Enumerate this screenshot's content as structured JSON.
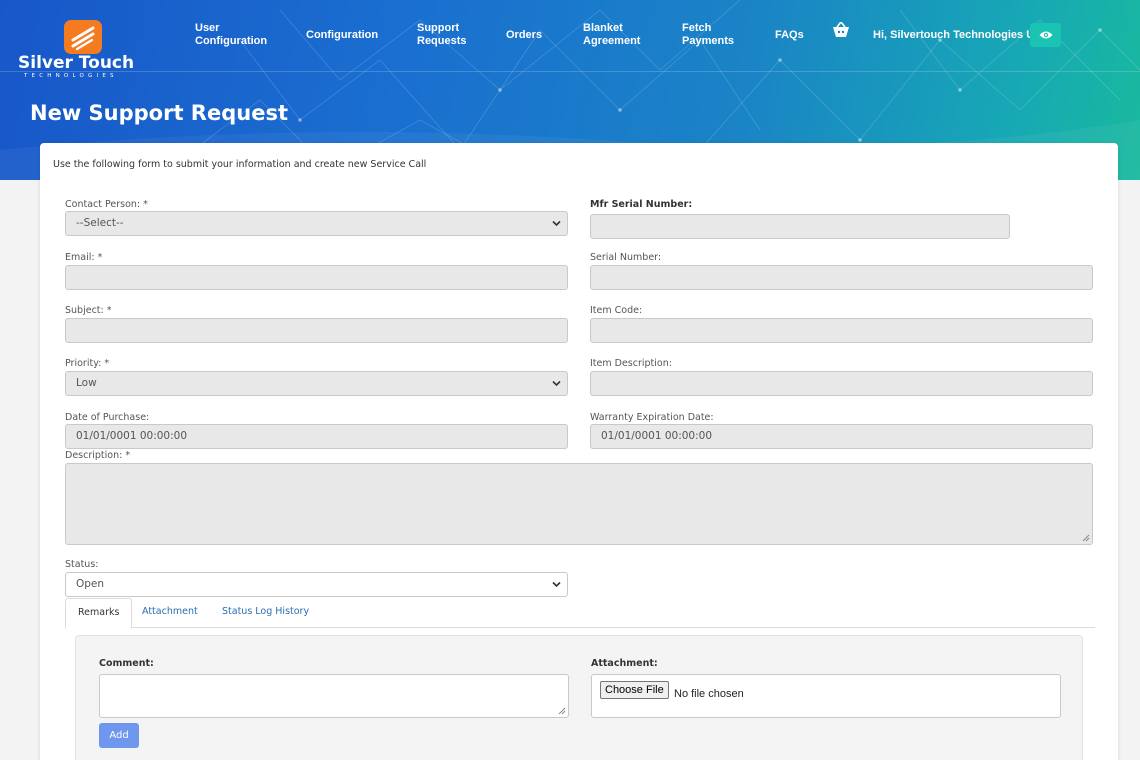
{
  "brand": {
    "name": "Silver Touch",
    "tagline": "TECHNOLOGIES"
  },
  "nav": {
    "items": [
      {
        "line1": "User",
        "line2": "Configuration"
      },
      {
        "line1": "Configuration",
        "line2": ""
      },
      {
        "line1": "Support",
        "line2": "Requests"
      },
      {
        "line1": "Orders",
        "line2": ""
      },
      {
        "line1": "Blanket",
        "line2": "Agreement"
      },
      {
        "line1": "Fetch",
        "line2": "Payments"
      },
      {
        "line1": "FAQs",
        "line2": ""
      }
    ],
    "greeting": "Hi, Silvertouch Technologies UK",
    "cart_icon": "cart-icon",
    "eye_icon": "eye-icon"
  },
  "page": {
    "title": "New Support Request",
    "intro": "Use the following form to submit your information and create new Service Call"
  },
  "form": {
    "contact_person": {
      "label": "Contact Person: *",
      "value": "--Select--"
    },
    "mfr_serial": {
      "label": "Mfr Serial Number:",
      "value": ""
    },
    "email": {
      "label": "Email: *",
      "value": ""
    },
    "serial_number": {
      "label": "Serial Number:",
      "value": ""
    },
    "subject": {
      "label": "Subject: *",
      "value": ""
    },
    "item_code": {
      "label": "Item Code:",
      "value": ""
    },
    "priority": {
      "label": "Priority: *",
      "value": "Low"
    },
    "item_description": {
      "label": "Item Description:",
      "value": ""
    },
    "date_of_purchase": {
      "label": "Date of Purchase:",
      "value": "01/01/0001 00:00:00"
    },
    "warranty_expiration": {
      "label": "Warranty Expiration Date:",
      "value": "01/01/0001 00:00:00"
    },
    "description": {
      "label": "Description: *",
      "value": ""
    },
    "status": {
      "label": "Status:",
      "value": "Open"
    }
  },
  "tabs": [
    {
      "label": "Remarks",
      "active": true
    },
    {
      "label": "Attachment",
      "active": false
    },
    {
      "label": "Status Log History",
      "active": false
    }
  ],
  "remarks": {
    "comment_label": "Comment:",
    "attachment_label": "Attachment:",
    "choose_file": "Choose File",
    "no_file": "No file chosen",
    "add_button": "Add"
  },
  "colors": {
    "banner_start": "#1857c9",
    "banner_end": "#19b99e",
    "accent_teal": "#1bc3b3",
    "add_button": "#6f97ee",
    "tab_link": "#2a6fb0"
  }
}
